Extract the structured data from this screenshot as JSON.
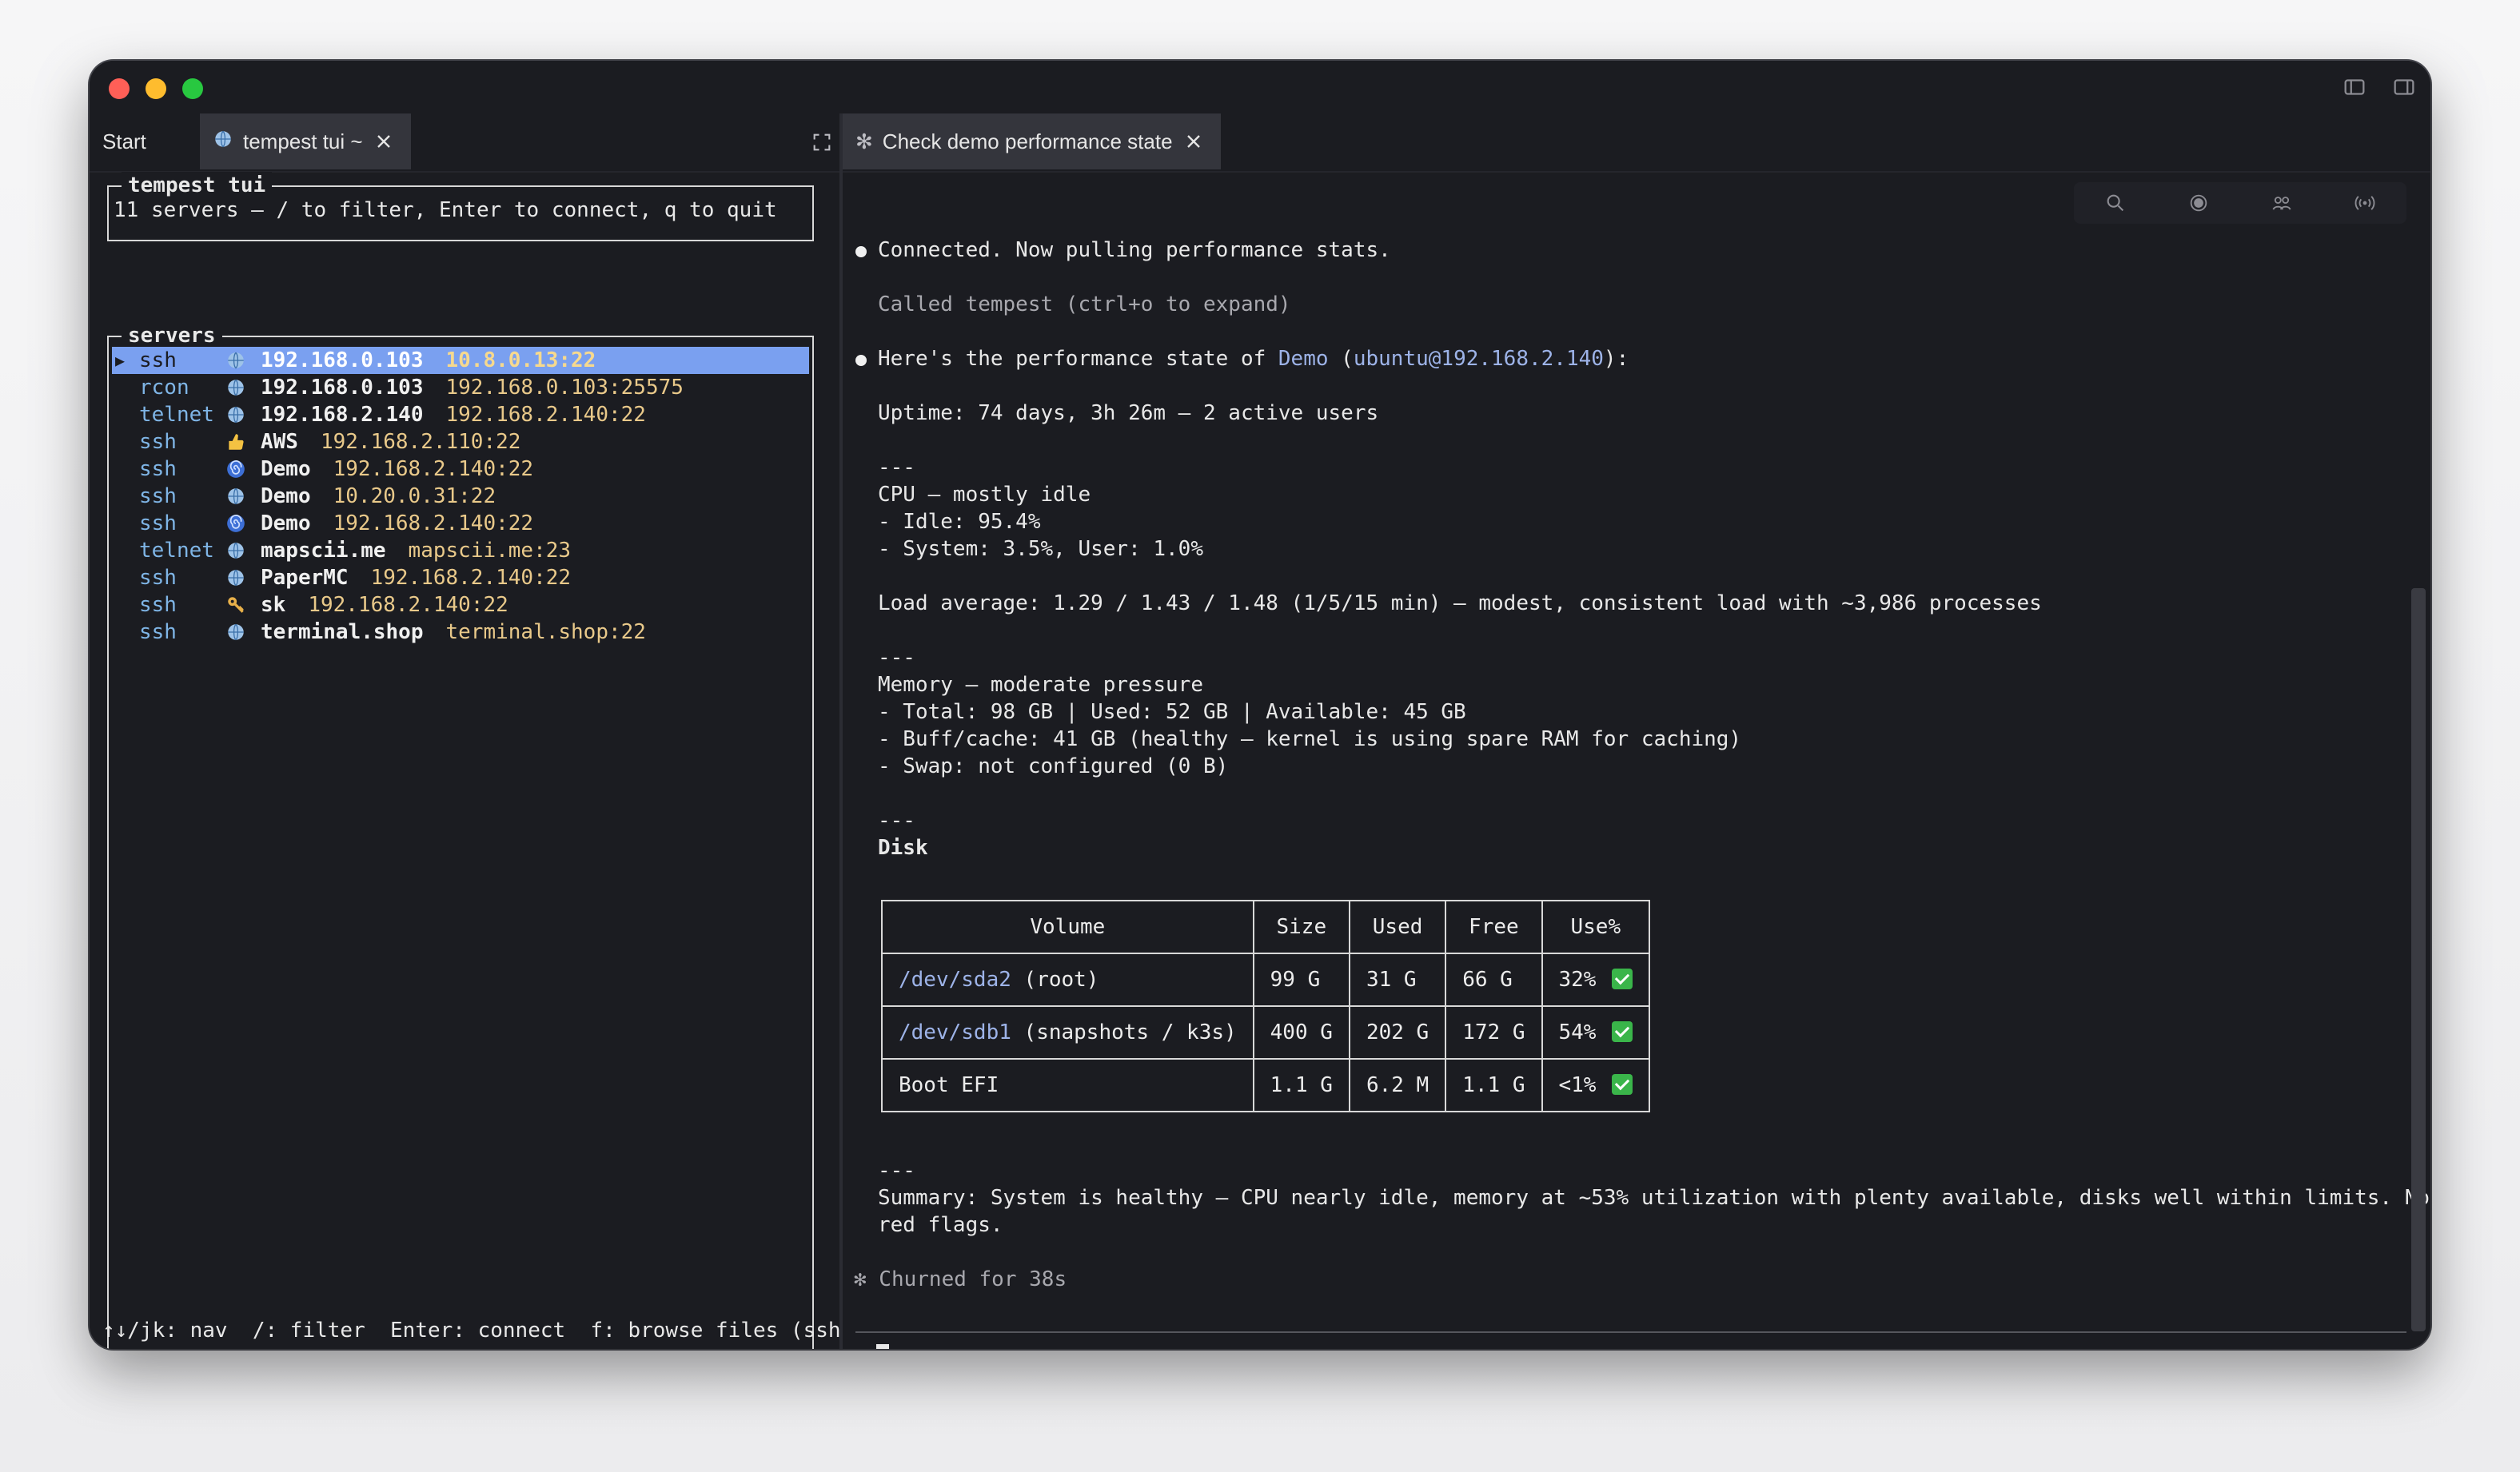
{
  "tabs": {
    "start_label": "Start",
    "left_active_label": "tempest tui ~",
    "right_active_label": "Check demo performance state"
  },
  "left_pane": {
    "header_legend": "tempest tui",
    "header_line": "11 servers – / to filter, Enter to connect, q to quit",
    "servers_legend": "servers",
    "servers": [
      {
        "protocol": "ssh",
        "icon": "globe-icon",
        "name": "192.168.0.103",
        "address": "10.8.0.13:22",
        "selected": true
      },
      {
        "protocol": "rcon",
        "icon": "globe-icon",
        "name": "192.168.0.103",
        "address": "192.168.0.103:25575"
      },
      {
        "protocol": "telnet",
        "icon": "globe-icon",
        "name": "192.168.2.140",
        "address": "192.168.2.140:22"
      },
      {
        "protocol": "ssh",
        "icon": "thumbs-up-icon",
        "name": "AWS",
        "address": "192.168.2.110:22"
      },
      {
        "protocol": "ssh",
        "icon": "spiral-icon",
        "name": "Demo",
        "address": "192.168.2.140:22"
      },
      {
        "protocol": "ssh",
        "icon": "globe-icon",
        "name": "Demo",
        "address": "10.20.0.31:22"
      },
      {
        "protocol": "ssh",
        "icon": "spiral-icon",
        "name": "Demo",
        "address": "192.168.2.140:22"
      },
      {
        "protocol": "telnet",
        "icon": "globe-icon",
        "name": "mapscii.me",
        "address": "mapscii.me:23"
      },
      {
        "protocol": "ssh",
        "icon": "globe-icon",
        "name": "PaperMC",
        "address": "192.168.2.140:22"
      },
      {
        "protocol": "ssh",
        "icon": "key-icon",
        "name": "sk",
        "address": "192.168.2.140:22"
      },
      {
        "protocol": "ssh",
        "icon": "globe-icon",
        "name": "terminal.shop",
        "address": "terminal.shop:22"
      }
    ],
    "footer": "↑↓/jk: nav  /: filter  Enter: connect  f: browse files (ssh)"
  },
  "right_pane": {
    "connected_line": "Connected. Now pulling performance stats.",
    "called_line": "Called tempest (ctrl+o to expand)",
    "state_prefix": "Here's the performance state of ",
    "state_host": "Demo",
    "state_paren_open": " (",
    "state_user": "ubuntu@192.168.2.140",
    "state_suffix": "):",
    "uptime_line": "Uptime: 74 days, 3h 26m – 2 active users",
    "sep1": "---",
    "cpu_title": "CPU – mostly idle",
    "cpu_idle": "- Idle: 95.4%",
    "cpu_system": "- System: 3.5%, User: 1.0%",
    "load_line": "Load average: 1.29 / 1.43 / 1.48 (1/5/15 min) – modest, consistent load with ~3,986 processes",
    "sep2": "---",
    "memory_title": "Memory – moderate pressure",
    "memory_total": "- Total: 98 GB | Used: 52 GB | Available: 45 GB",
    "memory_buff": "- Buff/cache: 41 GB (healthy – kernel is using spare RAM for caching)",
    "memory_swap": "- Swap: not configured (0 B)",
    "sep3": "---",
    "disk_title": "Disk",
    "disk_headers": [
      "Volume",
      "Size",
      "Used",
      "Free",
      "Use%"
    ],
    "disk_rows": [
      {
        "device": "/dev/sda2",
        "label": " (root)",
        "size": "99 G",
        "used": "31 G",
        "free": "66 G",
        "use": "32%"
      },
      {
        "device": "/dev/sdb1",
        "label": " (snapshots / k3s)",
        "size": "400 G",
        "used": "202 G",
        "free": "172 G",
        "use": "54%"
      },
      {
        "device": "",
        "label": "Boot EFI",
        "size": "1.1 G",
        "used": "6.2 M",
        "free": "1.1 G",
        "use": "<1%"
      }
    ],
    "sep4": "---",
    "summary_line1": "Summary: System is healthy – CPU nearly idle, memory at ~53% utilization with plenty available, disks well within limits. No",
    "summary_line2": "red flags.",
    "churned_line": "✻ Churned for 38s",
    "prompt_symbol": "❯"
  }
}
